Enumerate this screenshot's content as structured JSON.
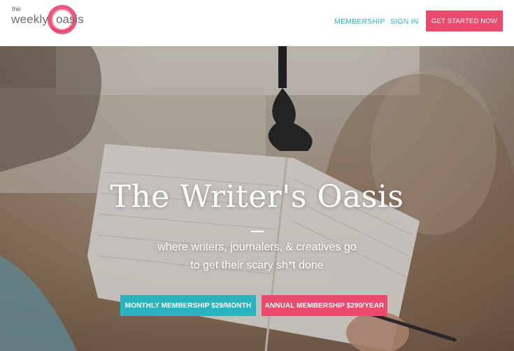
{
  "header": {
    "logo": {
      "small": "the",
      "weekly": "weekly",
      "oasis": "oasis",
      "icon": "brush-circle-icon"
    },
    "nav": {
      "membership": "MEMBERSHIP",
      "signin": "SIGN IN"
    },
    "cta": "GET STARTED NOW"
  },
  "hero": {
    "title": "The Writer's Oasis",
    "subtitle_line1": "where writers, journalers, & creatives go",
    "subtitle_line2": "to get their scary sh*t done",
    "buttons": {
      "monthly": "MONTHLY MEMBERSHIP $29/MONTH",
      "annual": "ANNUAL MEMBERSHIP $290/YEAR"
    }
  },
  "colors": {
    "teal": "#2bb3c0",
    "pink": "#ea4a6c"
  }
}
